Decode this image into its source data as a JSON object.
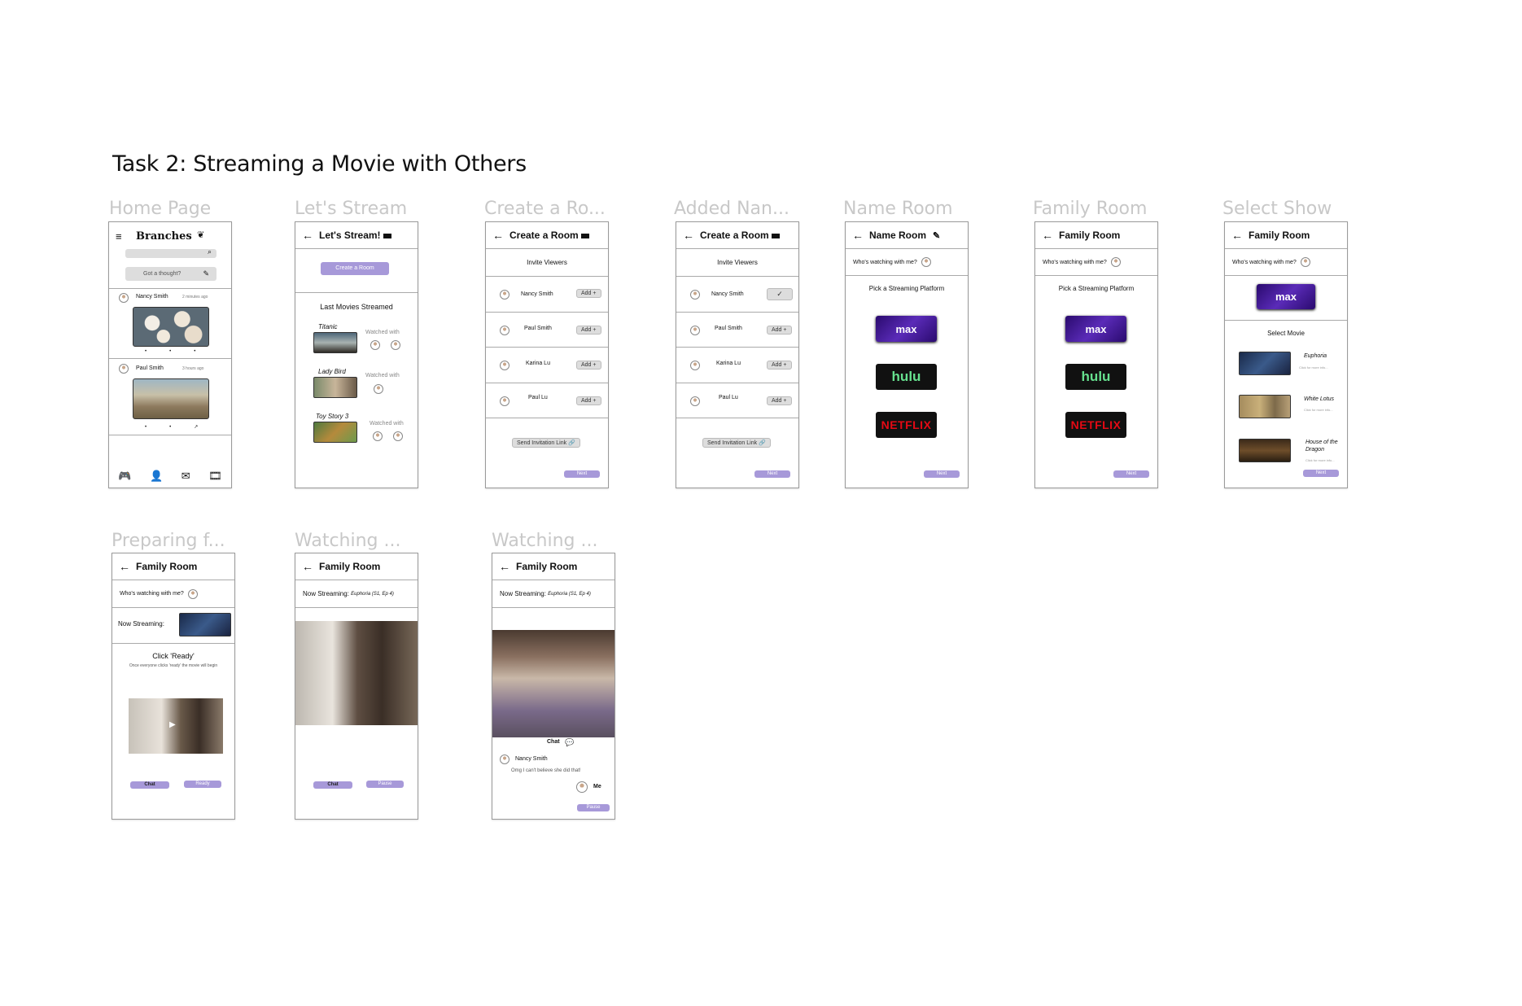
{
  "title": "Task 2: Streaming a Movie with Others",
  "frames": {
    "home": "Home Page",
    "stream": "Let's Stream",
    "create": "Create a Ro...",
    "added": "Added Nan...",
    "name": "Name Room",
    "family": "Family Room",
    "select": "Select Show",
    "preparing": "Preparing f...",
    "watching1": "Watching ...",
    "watching2": "Watching ..."
  },
  "home": {
    "brand": "Branches",
    "thought": "Got a thought?",
    "posts": [
      {
        "name": "Nancy Smith",
        "time": "2 minutes ago"
      },
      {
        "name": "Paul Smith",
        "time": "3 hours ago"
      }
    ]
  },
  "stream": {
    "header": "Let's Stream!",
    "create_button": "Create a Room",
    "section": "Last Movies Streamed",
    "movies": [
      {
        "title": "Titanic",
        "with": "Watched with"
      },
      {
        "title": "Lady Bird",
        "with": "Watched with"
      },
      {
        "title": "Toy Story 3",
        "with": "Watched with"
      }
    ]
  },
  "create": {
    "header": "Create a Room",
    "invite": "Invite Viewers",
    "viewers": [
      "Nancy Smith",
      "Paul Smith",
      "Karina Lu",
      "Paul Lu"
    ],
    "add": "Add +",
    "link": "Send Invitation Link",
    "next": "Next"
  },
  "name_room": {
    "header": "Name Room",
    "who": "Who's watching with me?",
    "pick": "Pick a Streaming Platform",
    "platforms": [
      "max",
      "hulu",
      "NETFLIX"
    ],
    "next": "Next"
  },
  "family": {
    "header": "Family Room",
    "who": "Who's watching with me?",
    "pick": "Pick a Streaming Platform",
    "next": "Next"
  },
  "select": {
    "header": "Family Room",
    "who": "Who's watching with me?",
    "section": "Select Movie",
    "shows": [
      {
        "title": "Euphoria",
        "sub": "Click for more info..."
      },
      {
        "title": "White Lotus",
        "sub": "Click for more info..."
      },
      {
        "title": "House of the Dragon",
        "sub": "Click for more info..."
      }
    ],
    "next": "Next"
  },
  "preparing": {
    "header": "Family Room",
    "who": "Who's watching with me?",
    "now": "Now Streaming:",
    "click": "Click 'Ready'",
    "note": "Once everyone clicks 'ready' the movie will begin",
    "chat": "Chat",
    "ready": "Ready"
  },
  "watching1": {
    "header": "Family Room",
    "now": "Now Streaming:",
    "show": "Euphoria (S1, Ep 4)",
    "chat": "Chat",
    "pause": "Pause"
  },
  "watching2": {
    "header": "Family Room",
    "now": "Now Streaming:",
    "show": "Euphoria (S1, Ep 4)",
    "chat": "Chat",
    "sender": "Nancy Smith",
    "message": "Omg I can't believe she did that!",
    "me": "Me",
    "pause": "Pause"
  },
  "colors": {
    "accent": "#a799d9",
    "frame_label": "#c8c8c8",
    "border": "#9a9a9a"
  }
}
